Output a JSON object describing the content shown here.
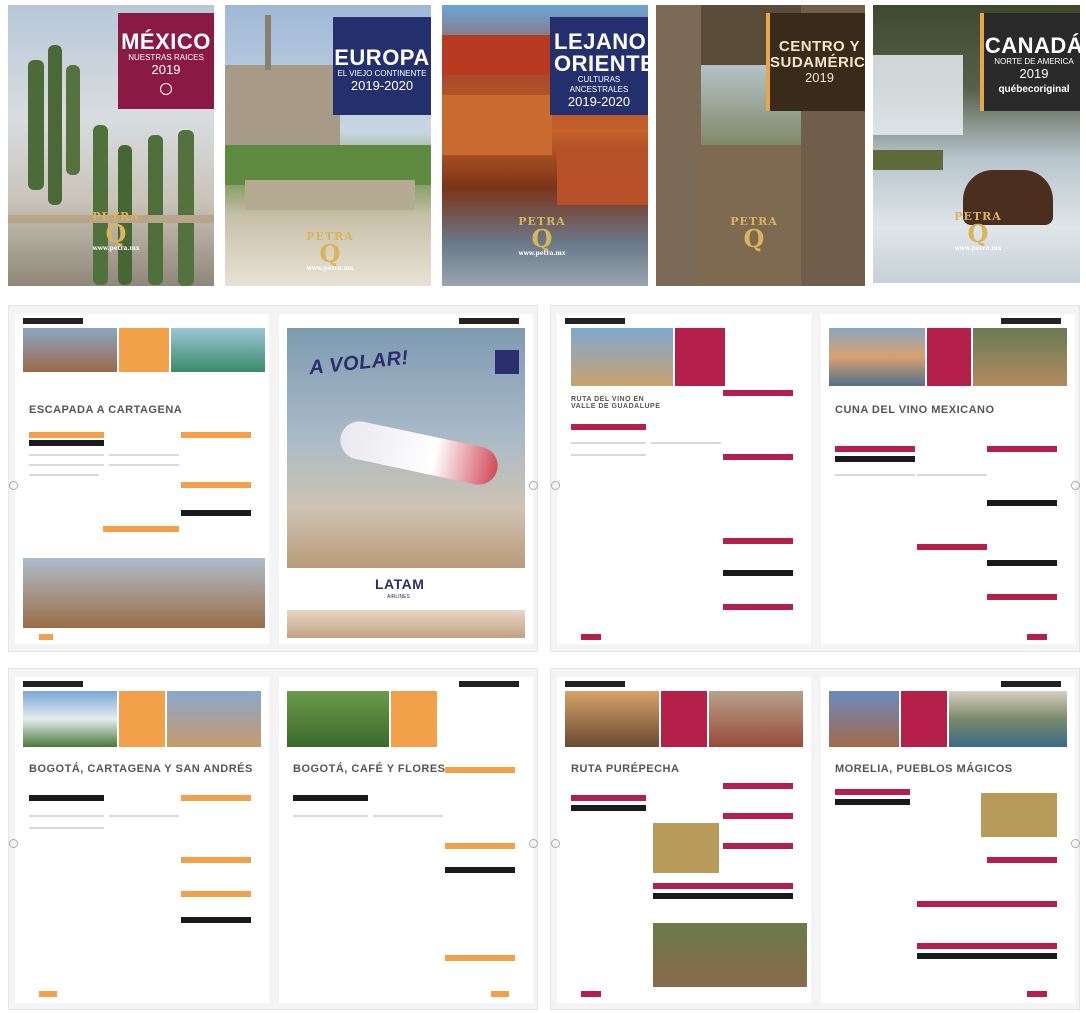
{
  "covers": [
    {
      "title": "MÉXICO",
      "subtitle": "NUESTRAS RAICES",
      "year": "2019",
      "brand": "PETRA",
      "url": "www.petra.mx",
      "box_color": "#8a1a44"
    },
    {
      "title": "EUROPA",
      "subtitle": "EL VIEJO CONTINENTE",
      "year": "2019-2020",
      "brand": "PETRA",
      "url": "www.petra.mx",
      "box_color": "#24306e"
    },
    {
      "title": "LEJANO ORIENTE",
      "subtitle": "CULTURAS ANCESTRALES",
      "year": "2019-2020",
      "brand": "PETRA",
      "url": "www.petra.mx",
      "box_color": "#24306e"
    },
    {
      "title": "CENTRO Y SUDAMÉRICA",
      "subtitle": "",
      "year": "2019",
      "brand": "PETRA",
      "url": "",
      "box_color": "#3a2a1a"
    },
    {
      "title": "CANADÁ",
      "subtitle": "NORTE DE AMERICA",
      "year": "2019",
      "brand": "PETRA",
      "url": "www.petra.mx",
      "extra": "québecoriginal",
      "box_color": "#2a2a2a"
    }
  ],
  "spreads": [
    {
      "left_heading": "ESCAPADA A CARTAGENA",
      "ad_title": "A VOLAR!",
      "ad_brand": "LATAM",
      "ad_sub": "AIRLINES"
    },
    {
      "left_heading": "RUTA DEL VINO EN VALLE DE GUADALUPE",
      "right_heading": "CUNA DEL VINO MEXICANO"
    },
    {
      "left_heading": "BOGOTÁ, CARTAGENA Y SAN ANDRÉS",
      "right_heading": "BOGOTÁ, CAFÉ Y FLORES"
    },
    {
      "left_heading": "RUTA PURÉPECHA",
      "right_heading": "MORELIA, PUEBLOS MÁGICOS"
    }
  ],
  "colors": {
    "orange": "#f2a14a",
    "crimson": "#b5204a",
    "black": "#1a1a1a",
    "gold": "#b89a5a"
  }
}
